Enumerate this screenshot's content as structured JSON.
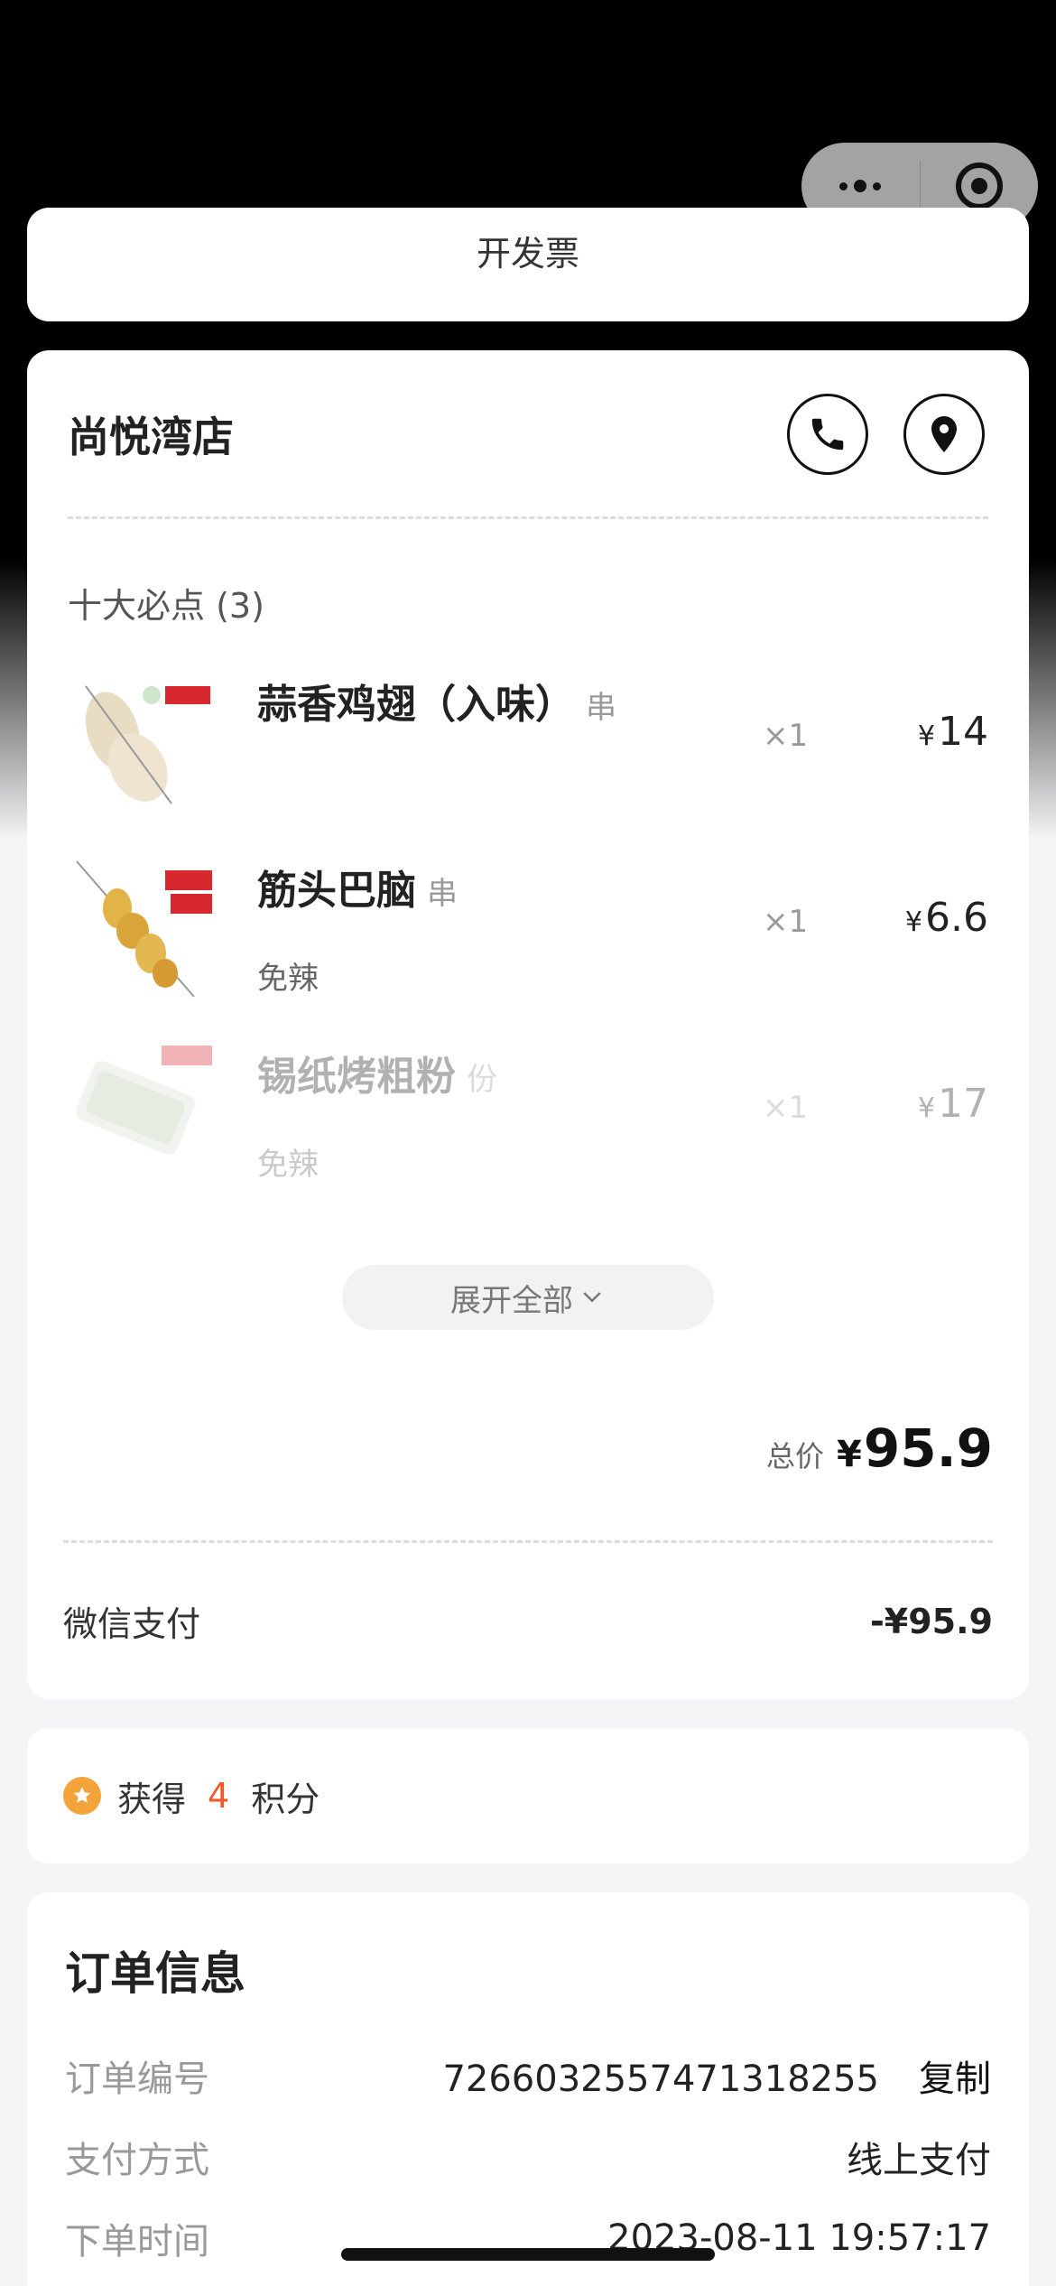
{
  "colors": {
    "accent": "#f0592a",
    "points_icon": "#f2a33a",
    "background": "#f5f5f7"
  },
  "capsule": {
    "more_icon": "ellipsis-icon",
    "close_icon": "target-icon"
  },
  "prev_card": {
    "cut_text": "开发票"
  },
  "store": {
    "name": "尚悦湾店",
    "phone_icon": "phone-icon",
    "location_icon": "location-pin-icon",
    "group_title": "十大必点 (3)",
    "items": [
      {
        "name": "蒜香鸡翅（入味）",
        "unit": "串",
        "spec": "",
        "qty": "×1",
        "currency": "¥",
        "price": "14"
      },
      {
        "name": "筋头巴脑",
        "unit": "串",
        "spec": "免辣",
        "qty": "×1",
        "currency": "¥",
        "price": "6.6"
      },
      {
        "name": "锡纸烤粗粉",
        "unit": "份",
        "spec": "免辣",
        "qty": "×1",
        "currency": "¥",
        "price": "17"
      }
    ],
    "expand_label": "展开全部",
    "total_label": "总价",
    "total_currency": "¥",
    "total_value": "95.9",
    "payment_label": "微信支付",
    "payment_value": "-¥95.9"
  },
  "points": {
    "prefix": "获得",
    "count": "4",
    "suffix": "积分"
  },
  "order": {
    "title": "订单信息",
    "number_label": "订单编号",
    "number_value": "7266032557471318255",
    "copy_label": "复制",
    "pay_method_label": "支付方式",
    "pay_method_value": "线上支付",
    "time_label": "下单时间",
    "time_value": "2023-08-11 19:57:17"
  }
}
